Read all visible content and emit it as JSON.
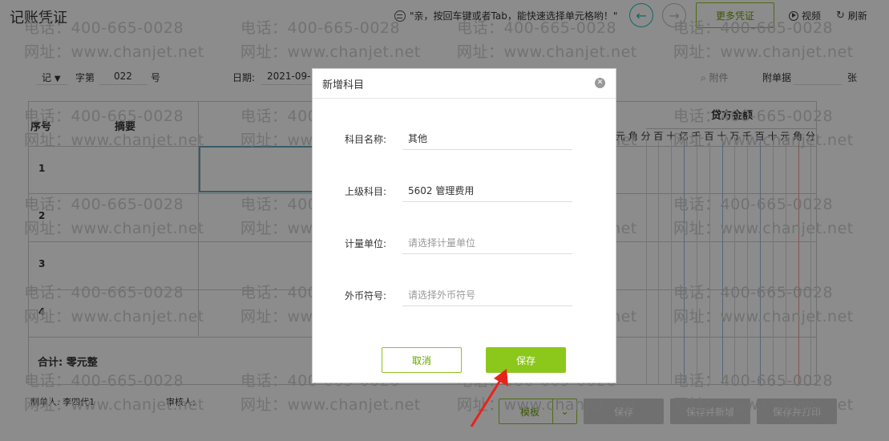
{
  "page": {
    "title": "记账凭证",
    "hint": "\"亲，按回车键或者Tab，能快速选择单元格哟！\"",
    "more_vouchers": "更多凭证",
    "video": "视频",
    "refresh": "刷新"
  },
  "voucher": {
    "type": "记",
    "zi_label": "字第",
    "number": "022",
    "hao_label": "号",
    "date_label": "日期:",
    "date_value": "2021-09-",
    "attachment": "附件",
    "attach_docs_label": "附单据",
    "zhang_label": "张"
  },
  "table": {
    "col_seq": "序号",
    "col_summary": "摘要",
    "col_credit": "贷方金额",
    "rows": [
      "1",
      "2",
      "3",
      "4"
    ],
    "digit_labels": [
      "元",
      "角",
      "分",
      "百",
      "十",
      "亿",
      "千",
      "百",
      "十",
      "万",
      "千",
      "百",
      "十",
      "元",
      "角",
      "分"
    ],
    "total": "合计:  零元整"
  },
  "footer": {
    "maker": "制单人: 李四代1",
    "reviewer": "审核人:",
    "template": "模板",
    "save": "保存",
    "save_new": "保存并新增",
    "save_print": "保存并打印"
  },
  "watermarks": {
    "phone": "电话：400-665-0028",
    "site": "网址：www.chanjet.net"
  },
  "modal": {
    "title": "新增科目",
    "fields": [
      {
        "label": "科目名称:",
        "value": "其他",
        "placeholder": ""
      },
      {
        "label": "上级科目:",
        "value": "5602  管理费用",
        "placeholder": ""
      },
      {
        "label": "计量单位:",
        "value": "",
        "placeholder": "请选择计量单位"
      },
      {
        "label": "外币符号:",
        "value": "",
        "placeholder": "请选择外币符号"
      }
    ],
    "cancel": "取消",
    "save": "保存"
  },
  "colors": {
    "accent_green": "#8cc71c",
    "teal": "#22bbbb",
    "annotation_red": "#e8231c"
  },
  "icons": [
    "help-chat-icon",
    "back-arrow-icon",
    "forward-arrow-icon",
    "video-play-icon",
    "refresh-icon",
    "dropdown-caret-icon",
    "paperclip-icon",
    "close-icon",
    "annotation-arrow-icon"
  ]
}
